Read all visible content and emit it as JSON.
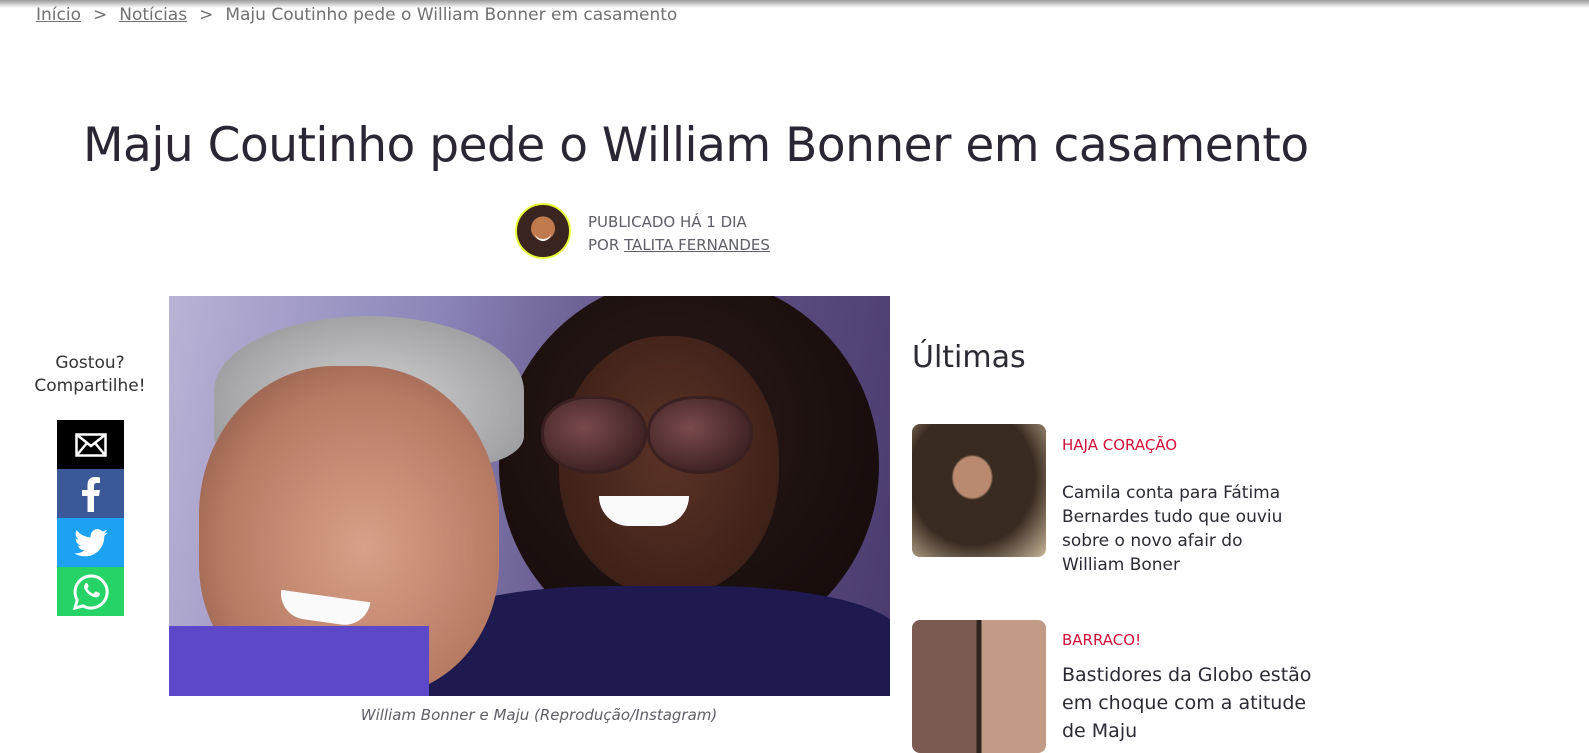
{
  "breadcrumb": {
    "items": [
      "Início",
      "Notícias"
    ],
    "separator": ">",
    "current": "Maju Coutinho pede o William Bonner em casamento"
  },
  "article": {
    "title": "Maju Coutinho pede o William Bonner em casamento",
    "published": "PUBLICADO HÁ 1 DIA",
    "by_prefix": "POR",
    "author": "TALITA FERNANDES",
    "image_caption": "William Bonner e Maju (Reprodução/Instagram)"
  },
  "share": {
    "label_line1": "Gostou?",
    "label_line2": "Compartilhe!",
    "buttons": [
      {
        "icon": "email-icon",
        "color": "#000000"
      },
      {
        "icon": "facebook-icon",
        "color": "#3b5998"
      },
      {
        "icon": "twitter-icon",
        "color": "#1da1f2"
      },
      {
        "icon": "whatsapp-icon",
        "color": "#25d366"
      }
    ]
  },
  "sidebar": {
    "title": "Últimas",
    "items": [
      {
        "category": "HAJA CORAÇÃO",
        "headline": "Camila conta para Fátima Bernardes tudo que ouviu sobre o novo afair do William Boner"
      },
      {
        "category": "BARRACO!",
        "headline": "Bastidores da Globo estão em choque com a atitude de Maju"
      }
    ]
  },
  "colors": {
    "category_accent": "#d0103a",
    "avatar_ring": "#e8ff3a"
  }
}
